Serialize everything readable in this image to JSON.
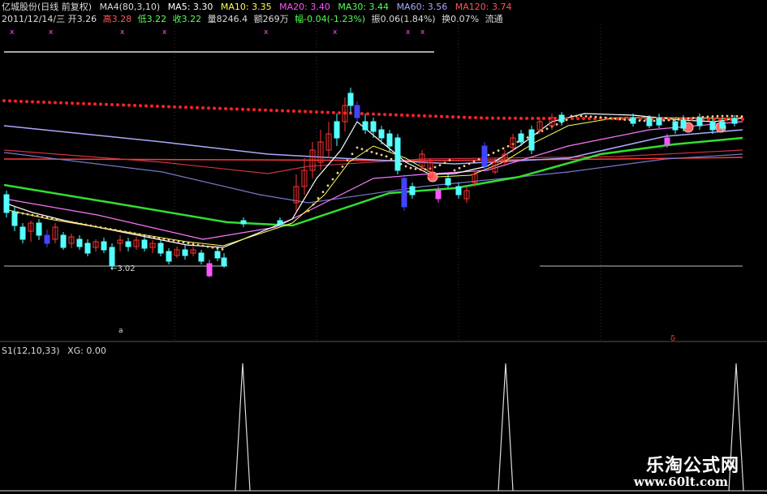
{
  "header": {
    "stock": "亿城股份(日线 前复权)",
    "ma4": "MA4(80,3,10)",
    "ma5": "MA5: 3.30",
    "ma10": "MA10: 3.35",
    "ma20": "MA20: 3.40",
    "ma30": "MA30: 3.44",
    "ma60": "MA60: 3.56",
    "ma120": "MA120: 3.74"
  },
  "quote": {
    "date": "2011/12/14/三",
    "open": "开3.26",
    "high": "高3.28",
    "low": "低3.22",
    "close": "收3.22",
    "volume": "量8246.4",
    "amount": "额269万",
    "change": "幅-0.04(-1.23%)",
    "amplitude": "振0.06(1.84%)",
    "turnover": "换0.07%",
    "float": "流通"
  },
  "colors": {
    "ma5": "#ffffff",
    "ma10": "#ffff55",
    "ma20": "#ff55ff",
    "ma30": "#55ff55",
    "ma60": "#aaaaff",
    "ma120": "#ff5555",
    "up": "#ff3333",
    "down": "#55ffff"
  },
  "price_label": "←3.02",
  "indicator": {
    "name": "S1(12,10,33)",
    "xg": "XG: 0.00"
  },
  "watermark": {
    "title": "乐淘公式网",
    "url": "www.60lt.com"
  }
}
